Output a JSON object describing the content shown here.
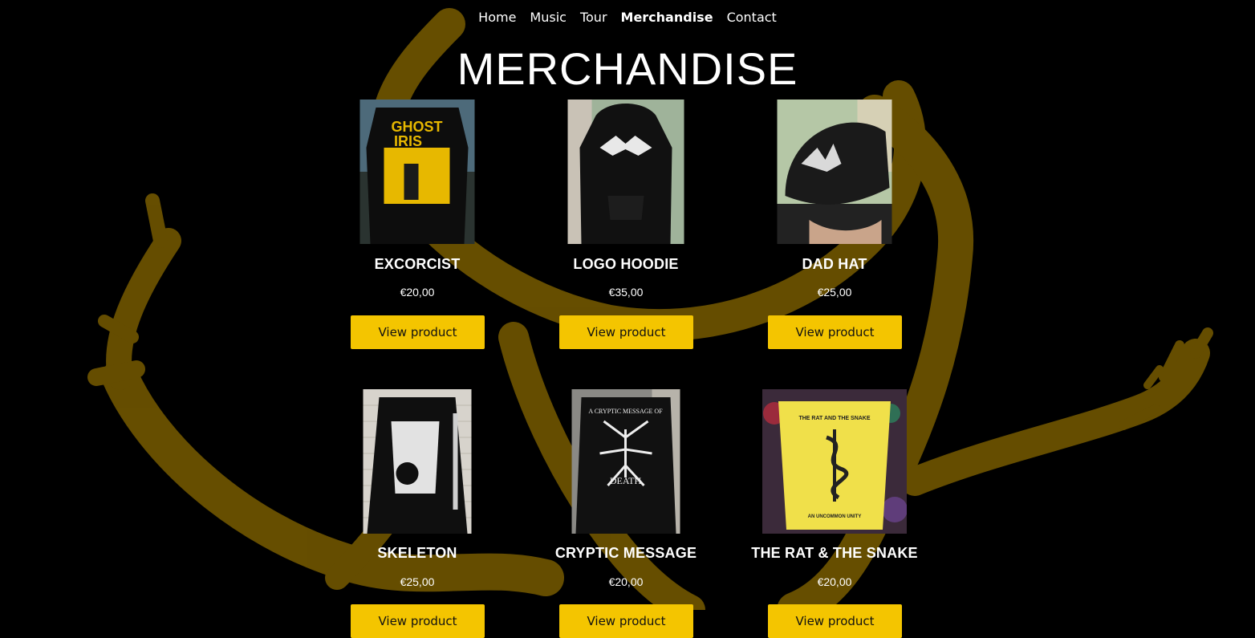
{
  "nav": {
    "items": [
      {
        "label": "Home",
        "active": false
      },
      {
        "label": "Music",
        "active": false
      },
      {
        "label": "Tour",
        "active": false
      },
      {
        "label": "Merchandise",
        "active": true
      },
      {
        "label": "Contact",
        "active": false
      }
    ]
  },
  "page": {
    "title": "MERCHANDISE"
  },
  "products": [
    {
      "name": "EXCORCIST",
      "price": "€20,00",
      "button": "View product",
      "image": "yellow-print-tshirt"
    },
    {
      "name": "LOGO HOODIE",
      "price": "€35,00",
      "button": "View product",
      "image": "black-logo-hoodie"
    },
    {
      "name": "DAD HAT",
      "price": "€25,00",
      "button": "View product",
      "image": "black-cap"
    },
    {
      "name": "SKELETON",
      "price": "€25,00",
      "button": "View product",
      "image": "longsleeve-skeleton"
    },
    {
      "name": "CRYPTIC MESSAGE",
      "price": "€20,00",
      "button": "View product",
      "image": "spider-print-tshirt"
    },
    {
      "name": "THE RAT & THE SNAKE",
      "price": "€20,00",
      "button": "View product",
      "image": "yellow-snake-tshirt"
    }
  ],
  "colors": {
    "accent": "#f4c500",
    "background": "#000000",
    "brush": "#6b5200"
  }
}
